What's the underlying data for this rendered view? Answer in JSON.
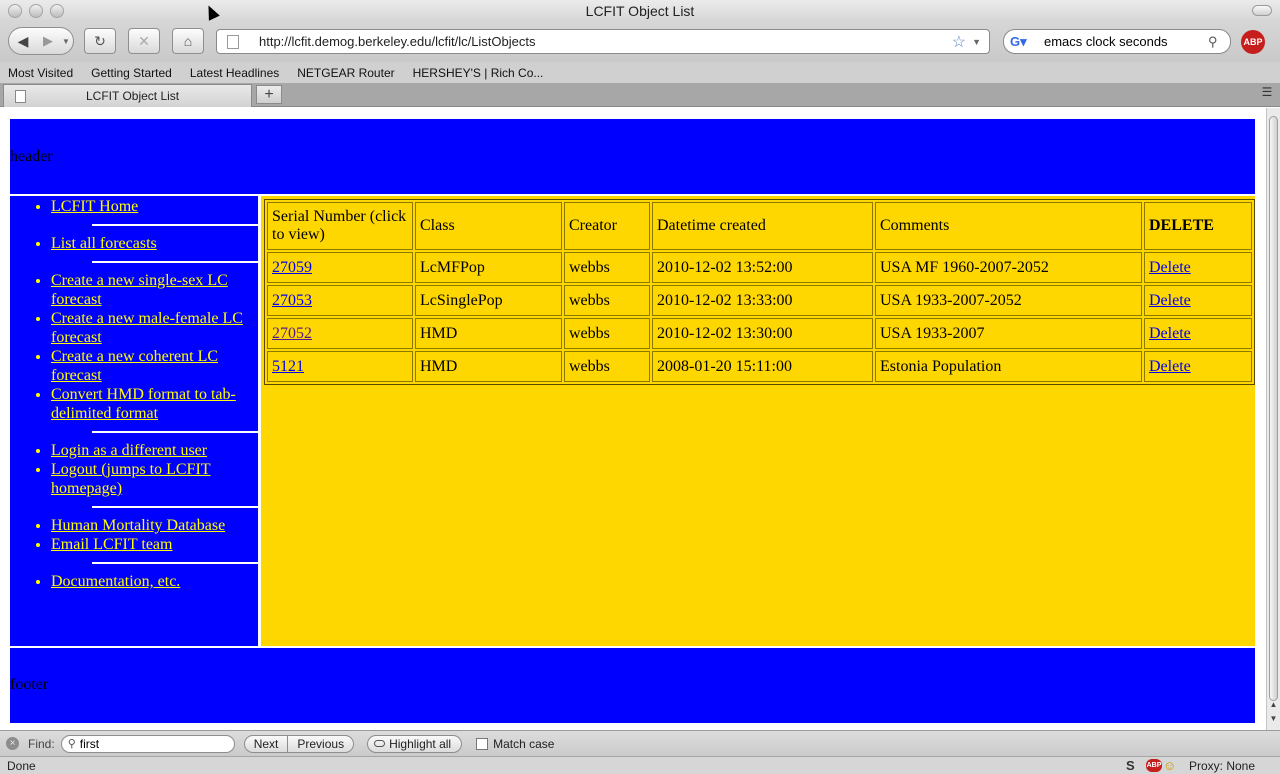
{
  "window": {
    "title": "LCFIT Object List"
  },
  "toolbar": {
    "url": "http://lcfit.demog.berkeley.edu/lcfit/lc/ListObjects",
    "search_value": "emacs clock seconds",
    "abp_label": "ABP"
  },
  "bookmarks": [
    "Most Visited",
    "Getting Started",
    "Latest Headlines",
    "NETGEAR Router",
    "HERSHEY'S | Rich Co..."
  ],
  "tab": {
    "title": "LCFIT Object List"
  },
  "page": {
    "header_text": "header",
    "footer_text": "footer",
    "sidebar": {
      "groups": [
        [
          "LCFIT Home"
        ],
        [
          "List all forecasts"
        ],
        [
          "Create a new single-sex LC forecast",
          "Create a new male-female LC forecast",
          "Create a new coherent LC forecast",
          "Convert HMD format to tab-delimited format"
        ],
        [
          "Login as a different user",
          "Logout (jumps to LCFIT homepage)"
        ],
        [
          "Human Mortality Database",
          "Email LCFIT team"
        ],
        [
          "Documentation, etc."
        ]
      ]
    },
    "table": {
      "headers": [
        "Serial Number (click to view)",
        "Class",
        "Creator",
        "Datetime created",
        "Comments",
        "DELETE"
      ],
      "rows": [
        {
          "serial": "27059",
          "class": "LcMFPop",
          "creator": "webbs",
          "datetime": "2010-12-02 13:52:00",
          "comments": "USA MF 1960-2007-2052",
          "delete": "Delete"
        },
        {
          "serial": "27053",
          "class": "LcSinglePop",
          "creator": "webbs",
          "datetime": "2010-12-02 13:33:00",
          "comments": "USA 1933-2007-2052",
          "delete": "Delete"
        },
        {
          "serial": "27052",
          "class": "HMD",
          "creator": "webbs",
          "datetime": "2010-12-02 13:30:00",
          "comments": "USA 1933-2007",
          "delete": "Delete"
        },
        {
          "serial": "5121",
          "class": "HMD",
          "creator": "webbs",
          "datetime": "2008-01-20 15:11:00",
          "comments": "Estonia Population",
          "delete": "Delete"
        }
      ]
    }
  },
  "findbar": {
    "label": "Find:",
    "value": "first",
    "next": "Next",
    "previous": "Previous",
    "highlight_all": "Highlight all",
    "match_case": "Match case"
  },
  "status": {
    "text": "Done",
    "proxy": "Proxy: None"
  },
  "colors": {
    "page_blue": "#0000ff",
    "content_gold": "#ffd700",
    "link_yellow": "#ffff00",
    "link_blue": "#0000ee",
    "visited": "#551a8b"
  }
}
